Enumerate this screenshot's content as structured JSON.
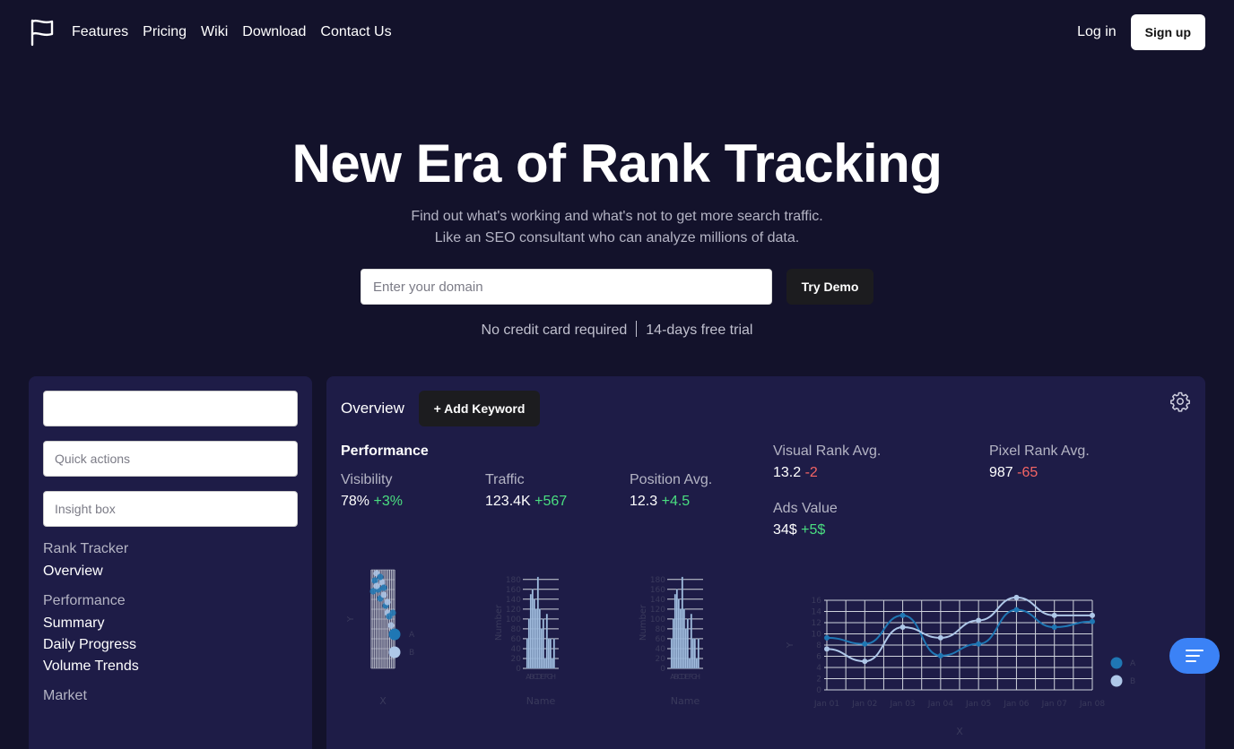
{
  "nav": {
    "logo_icon": "flag-icon",
    "links": [
      "Features",
      "Pricing",
      "Wiki",
      "Download",
      "Contact Us"
    ],
    "login": "Log in",
    "signup": "Sign up"
  },
  "hero": {
    "title": "New Era of Rank Tracking",
    "subtitle_line1": "Find out what's working and what's not to get more search traffic.",
    "subtitle_line2": "Like an SEO consultant who can analyze millions of data.",
    "domain_placeholder": "Enter your domain",
    "try_demo": "Try Demo",
    "note_left": "No credit card required",
    "note_right": "14-days free trial"
  },
  "sidebar": {
    "input1_placeholder": "",
    "quick_actions": "Quick actions",
    "insight_box": "Insight box",
    "sections": [
      {
        "title": "Rank Tracker",
        "items": [
          "Overview"
        ]
      },
      {
        "title": "Performance",
        "items": [
          "Summary",
          "Daily Progress",
          "Volume Trends"
        ]
      },
      {
        "title": "Market",
        "items": []
      }
    ]
  },
  "dashboard": {
    "tab": "Overview",
    "add_keyword": "+ Add Keyword",
    "settings_icon": "gear-icon",
    "performance_title": "Performance",
    "metrics": [
      {
        "label": "Visibility",
        "value": "78%",
        "delta": "+3%",
        "trend": "up"
      },
      {
        "label": "Traffic",
        "value": "123.4K",
        "delta": "+567",
        "trend": "up"
      },
      {
        "label": "Position Avg.",
        "value": "12.3",
        "delta": "+4.5",
        "trend": "up"
      },
      {
        "label": "Visual Rank Avg.",
        "value": "13.2",
        "delta": "-2",
        "trend": "down"
      },
      {
        "label": "Pixel Rank Avg.",
        "value": "987",
        "delta": "-65",
        "trend": "down"
      },
      {
        "label": "Ads Value",
        "value": "34$",
        "delta": "+5$",
        "trend": "up"
      }
    ]
  },
  "colors": {
    "series_a": "#1f77b4",
    "series_b": "#aec7e8",
    "up": "#4ade80",
    "down": "#f56565",
    "accent": "#3b82f6"
  },
  "chart_data": [
    {
      "type": "scatter",
      "xlabel": "X",
      "ylabel": "Y",
      "legend": [
        "A",
        "B"
      ]
    },
    {
      "type": "bar",
      "xlabel": "Name",
      "ylabel": "Number",
      "categories": [
        "A",
        "B",
        "C",
        "D",
        "E",
        "F",
        "G",
        "H"
      ],
      "yticks": [
        0,
        20,
        40,
        60,
        80,
        100,
        120,
        140,
        160,
        180
      ],
      "values": [
        [
          60,
          100
        ],
        [
          150,
          160
        ],
        [
          140,
          120
        ],
        [
          185,
          120
        ],
        [
          80,
          100
        ],
        [
          20,
          110
        ],
        [
          60,
          60
        ],
        [
          20,
          60
        ]
      ]
    },
    {
      "type": "bar",
      "xlabel": "Name",
      "ylabel": "Number",
      "categories": [
        "A",
        "B",
        "C",
        "D",
        "E",
        "F",
        "G",
        "H"
      ],
      "yticks": [
        0,
        20,
        40,
        60,
        80,
        100,
        120,
        140,
        160,
        180
      ],
      "values": [
        [
          60,
          100
        ],
        [
          150,
          160
        ],
        [
          140,
          120
        ],
        [
          185,
          120
        ],
        [
          80,
          100
        ],
        [
          20,
          110
        ],
        [
          60,
          60
        ],
        [
          20,
          60
        ]
      ]
    },
    {
      "type": "line",
      "xlabel": "X",
      "ylabel": "Y",
      "x": [
        "Jan 01",
        "Jan 02",
        "Jan 03",
        "Jan 04",
        "Jan 05",
        "Jan 06",
        "Jan 07",
        "Jan 08"
      ],
      "yticks": [
        0,
        2,
        4,
        6,
        8,
        10,
        12,
        14,
        16
      ],
      "series": [
        {
          "name": "A",
          "values": [
            9.3,
            8.2,
            13.3,
            6.1,
            8.2,
            14.3,
            11.2,
            12.2
          ]
        },
        {
          "name": "B",
          "values": [
            7.3,
            5.1,
            11.2,
            9.3,
            12.4,
            16.5,
            13.3,
            13.3
          ]
        }
      ]
    }
  ]
}
